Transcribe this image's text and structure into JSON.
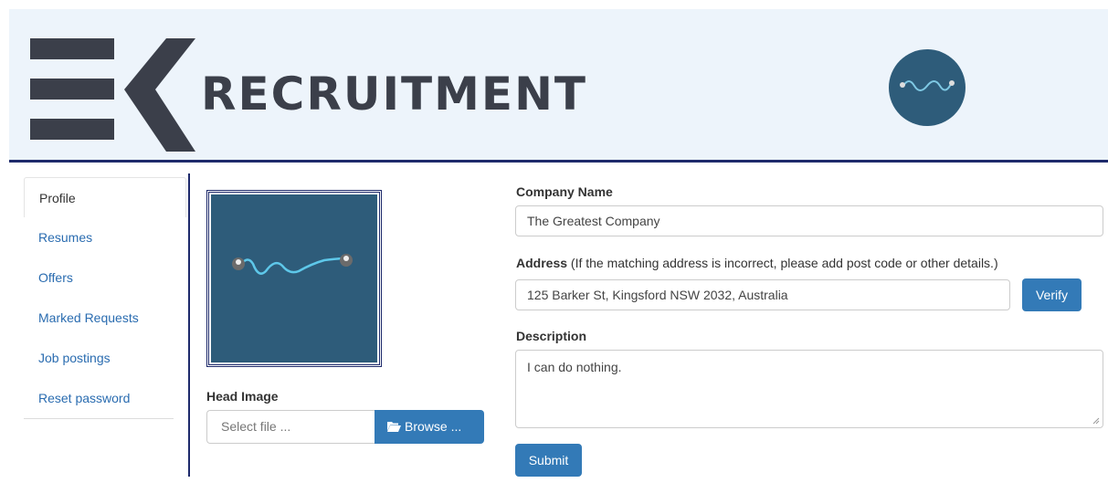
{
  "brand": {
    "logo_text": "RECRUITMENT",
    "colors": {
      "navy": "#1e2a6b",
      "header_bg": "#edf4fb",
      "accent": "#337ab7",
      "avatar_bg": "#2e5c7a"
    }
  },
  "sidebar": {
    "items": [
      {
        "label": "Profile"
      },
      {
        "label": "Resumes"
      },
      {
        "label": "Offers"
      },
      {
        "label": "Marked Requests"
      },
      {
        "label": "Job postings"
      },
      {
        "label": "Reset password"
      }
    ]
  },
  "head_image": {
    "label": "Head Image",
    "file_placeholder": "Select file ...",
    "browse_label": "Browse ...",
    "browse_icon": "folder-open-icon"
  },
  "form": {
    "company_name_label": "Company Name",
    "company_name_value": "The Greatest Company",
    "address_label": "Address",
    "address_hint": "(If the matching address is incorrect, please add post code or other details.)",
    "address_value": "125 Barker St, Kingsford NSW 2032, Australia",
    "verify_label": "Verify",
    "description_label": "Description",
    "description_value": "I can do nothing.",
    "submit_label": "Submit"
  }
}
